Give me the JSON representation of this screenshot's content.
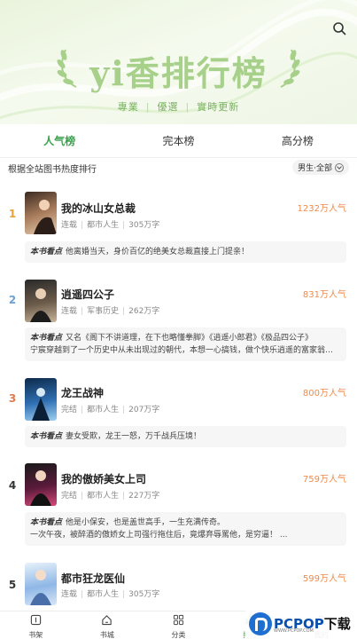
{
  "banner": {
    "title": "yi香排行榜",
    "tags": [
      "專業",
      "優選",
      "實時更新"
    ]
  },
  "tabs": [
    {
      "label": "人气榜",
      "active": true
    },
    {
      "label": "完本榜",
      "active": false
    },
    {
      "label": "高分榜",
      "active": false
    }
  ],
  "subhead": {
    "description": "根据全站图书热度排行",
    "filter_label": "男生·全部"
  },
  "books": [
    {
      "rank": "1",
      "rank_color": "#e8a33b",
      "title": "我的冰山女总裁",
      "status": "连载",
      "category": "都市人生",
      "words": "305万字",
      "heat": "1232万人气",
      "blurb_label": "本书看点",
      "blurb": "他离婚当天，身价百亿的绝美女总裁直接上门提亲！",
      "blurb_line2": ""
    },
    {
      "rank": "2",
      "rank_color": "#6aa0d6",
      "title": "逍遥四公子",
      "status": "连载",
      "category": "军事历史",
      "words": "262万字",
      "heat": "831万人气",
      "blurb_label": "本书看点",
      "blurb": "又名《阁下不讲道理，在下也略懂拳脚》《逍遥小郎君》《极品四公子》",
      "blurb_line2": "宁宸穿越到了一个历史中从未出现过的朝代，本想一心搞钱，做个快乐逍遥的富家翁，三妻四妾，..."
    },
    {
      "rank": "3",
      "rank_color": "#e07a4f",
      "title": "龙王战神",
      "status": "完结",
      "category": "都市人生",
      "words": "207万字",
      "heat": "800万人气",
      "blurb_label": "本书看点",
      "blurb": "妻女受欺，龙王一怒，万千战兵压境！",
      "blurb_line2": ""
    },
    {
      "rank": "4",
      "rank_color": "#333333",
      "title": "我的傲娇美女上司",
      "status": "完结",
      "category": "都市人生",
      "words": "227万字",
      "heat": "759万人气",
      "blurb_label": "本书看点",
      "blurb": "他是小保安，也是盖世高手，一生充满传奇。",
      "blurb_line2": "一次午夜，被醉酒的傲娇女上司强行拖住后，竟爆弃辱罵他，是穷逼！ ..."
    },
    {
      "rank": "5",
      "rank_color": "#333333",
      "title": "都市狂龙医仙",
      "status": "连载",
      "category": "都市人生",
      "words": "305万字",
      "heat": "599万人气",
      "blurb_label": "",
      "blurb": "",
      "blurb_line2": ""
    }
  ],
  "nav": [
    {
      "label": "书架",
      "icon": "bookshelf-icon",
      "active": false
    },
    {
      "label": "书城",
      "icon": "home-icon",
      "active": false
    },
    {
      "label": "分类",
      "icon": "grid-icon",
      "active": false
    },
    {
      "label": "排行",
      "icon": "rank-icon",
      "active": true
    },
    {
      "label": "我的",
      "icon": "user-icon",
      "active": false
    }
  ],
  "watermark": {
    "brand": "PCPOP",
    "suffix": "下载",
    "sub": "WWW.PCPOP.COM"
  },
  "colors": {
    "accent": "#3da04f",
    "heat": "#f08a4b",
    "banner_title": "#a7d18a"
  }
}
